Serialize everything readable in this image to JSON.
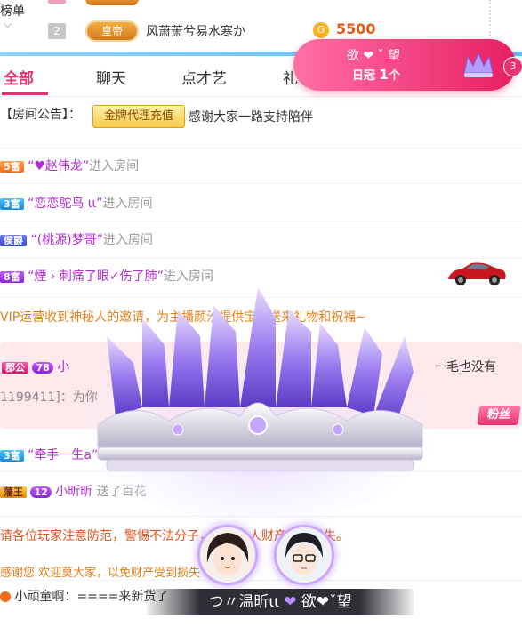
{
  "ranking": {
    "title": "榜单",
    "rank2": "2",
    "rank2_badge": "皇帝",
    "rank2_name": "风萧萧兮易水寒か",
    "rank2_coin": "G",
    "rank2_value": "5500"
  },
  "popup": {
    "name": "欲 ❤ ˇ 望",
    "sub_prefix": "日冠",
    "sub_count": "1",
    "sub_suffix": "个",
    "badge": "3"
  },
  "tabs": [
    "全部",
    "聊天",
    "点才艺",
    "礼"
  ],
  "notice": {
    "prefix": "【房间公告】：",
    "button": "金牌代理充值",
    "text": "感谢大家一路支持陪伴"
  },
  "entries": [
    {
      "tag": "5富",
      "name": "“♥赵伟龙”",
      "action": "进入房间"
    },
    {
      "tag": "3富",
      "name": "“恋恋鸵鸟 ιι”",
      "action": "进入房间"
    },
    {
      "tag": "侯爵",
      "name": "“(桃源)梦哥”",
      "action": "进入房间"
    },
    {
      "tag": "8富",
      "name": "“煙 › 刺痛了眼✓伤了肺”",
      "action": "进入房间"
    }
  ],
  "system_msg": "VIP运营收到神秘人的邀请，为主播颜汐提供宝贝送来礼物和祝福~",
  "fan_box": {
    "tag": "郡公",
    "level": "78",
    "name": "小",
    "text": "一毛也没有",
    "line2": "1199411]：为你",
    "badge": "粉丝"
  },
  "entry5": {
    "tag": "3富",
    "name": "“牵手一生a”"
  },
  "entry6": {
    "tag": "藩王",
    "level": "12",
    "name": "小昕昕",
    "action": "送了百花"
  },
  "warning": "请各位玩家注意防范，警惕不法分子，以免个人财产受到损失。",
  "warning2": "感谢您 欢迎莫大家，以免财产受到损失",
  "bottom_msg": "小顽童啊：====来新货了",
  "couple": {
    "left": "つ〃温昕ιι",
    "heart": "❤",
    "right": "欲❤ˇ望"
  },
  "colors": {
    "accent": "#e8336f",
    "notice_orange": "#e07f1a",
    "name_purple": "#b62ad8",
    "warn_red": "#e0511b"
  }
}
